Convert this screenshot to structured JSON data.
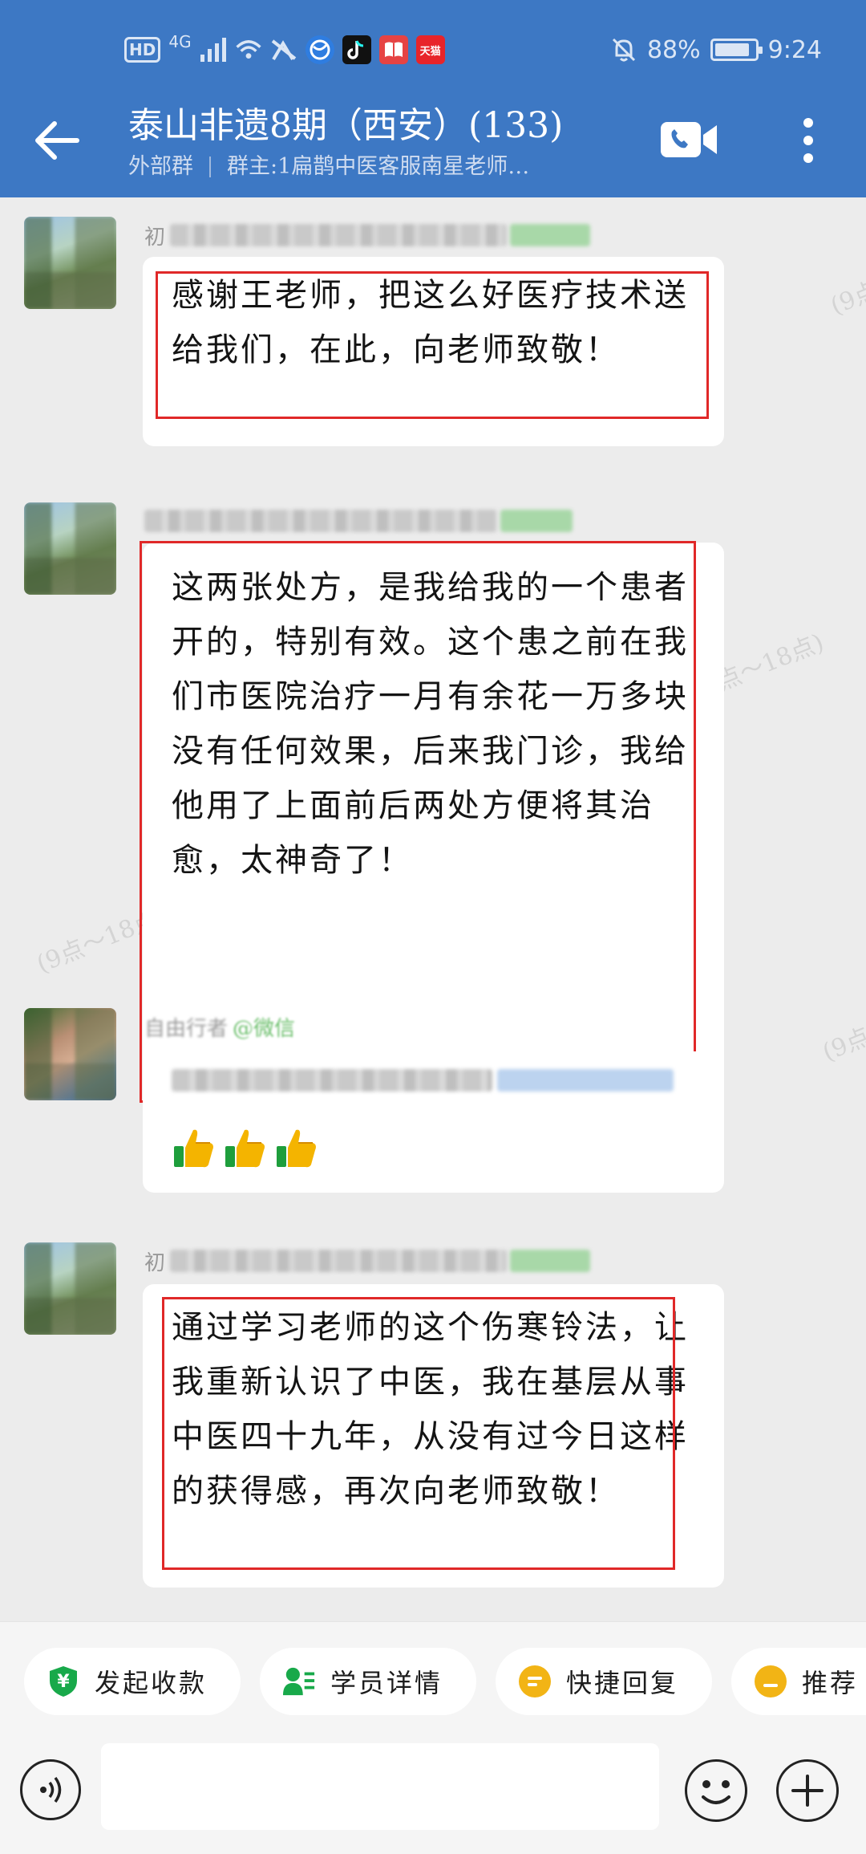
{
  "status_bar": {
    "hd": "HD",
    "network": "4G",
    "tmall_label": "天猫",
    "battery_percent": "88%",
    "battery_level": 0.88,
    "time": "9:24"
  },
  "header": {
    "title": "泰山非遗8期（西安）(133)",
    "group_type": "外部群",
    "owner": "群主:1扁鹊中医客服南星老师…"
  },
  "messages": [
    {
      "sender_prefix": "初",
      "text": "感谢王老师，把这么好医疗技术送给我们，在此，向老师致敬！"
    },
    {
      "sender_prefix": "",
      "text": "这两张处方，是我给我的一个患者开的，特别有效。这个患之前在我们市医院治疗一月有余花一万多块没有任何效果，后来我门诊，我给他用了上面前后两处方便将其治愈，太神奇了！"
    },
    {
      "sender_prefix": "自由行者",
      "sender_tag": "@微信",
      "text": "",
      "emojis": [
        "thumbs-up",
        "thumbs-up",
        "thumbs-up"
      ]
    },
    {
      "sender_prefix": "初",
      "text": "通过学习老师的这个伤寒铃法，让我重新认识了中医，我在基层从事中医四十九年，从没有过今日这样的获得感，再次向老师致敬！"
    }
  ],
  "watermark": "(9点～18点)",
  "quick_actions": [
    {
      "label": "发起收款",
      "icon": "payment-shield-icon",
      "color": "#18a94a"
    },
    {
      "label": "学员详情",
      "icon": "student-card-icon",
      "color": "#18a94a"
    },
    {
      "label": "快捷回复",
      "icon": "quick-reply-icon",
      "color": "#f2b415"
    },
    {
      "label": "推荐",
      "icon": "recommend-icon",
      "color": "#f2b415"
    }
  ],
  "input": {
    "placeholder": ""
  },
  "colors": {
    "header_bg": "#3d78c4",
    "highlight": "#e02828",
    "chat_bg": "#ececec"
  }
}
